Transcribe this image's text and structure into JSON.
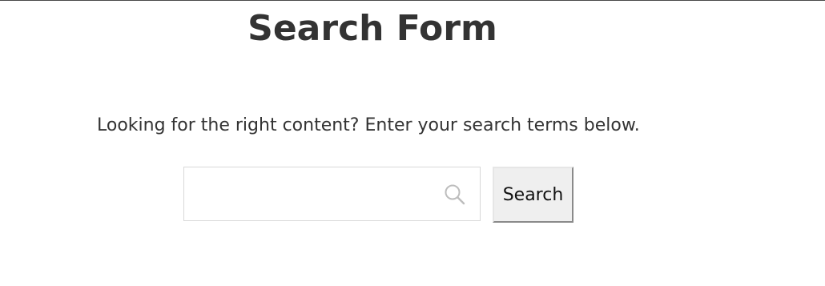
{
  "page": {
    "title": "Search Form",
    "intro": "Looking for the right content? Enter your search terms below."
  },
  "search": {
    "value": "",
    "placeholder": "",
    "icon": "search-icon",
    "button_label": "Search"
  },
  "colors": {
    "text": "#333333",
    "field_border": "#d8d8d8",
    "button_bg": "#efefef",
    "icon": "#bdbdbd"
  }
}
